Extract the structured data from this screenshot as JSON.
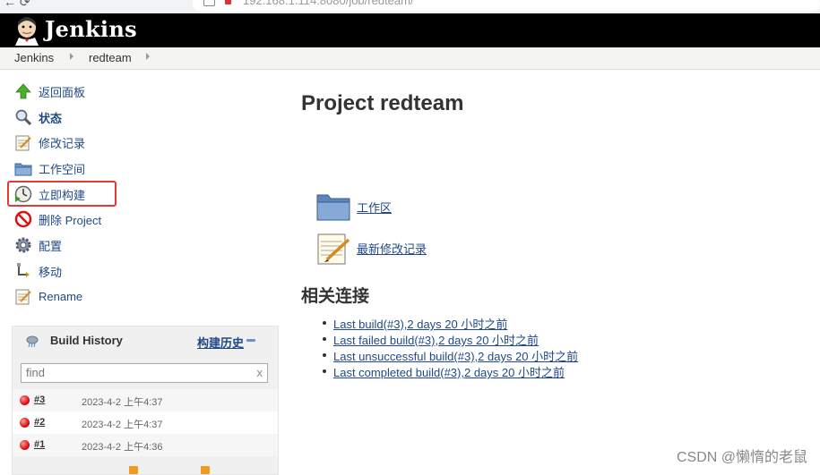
{
  "browser": {
    "nav": "←  ⟳",
    "address": "192.168.1.114:8080/job/redteam/"
  },
  "header": {
    "app_name": "Jenkins"
  },
  "breadcrumb": {
    "items": [
      "Jenkins",
      "redteam"
    ]
  },
  "sidebar": {
    "tasks": [
      {
        "label": "返回面板",
        "icon": "up-arrow-icon"
      },
      {
        "label": "状态",
        "icon": "search-icon"
      },
      {
        "label": "修改记录",
        "icon": "notepad-icon"
      },
      {
        "label": "工作空间",
        "icon": "folder-icon"
      },
      {
        "label": "立即构建",
        "icon": "clock-icon"
      },
      {
        "label": "删除 Project",
        "icon": "no-entry-icon"
      },
      {
        "label": "配置",
        "icon": "gear-icon"
      },
      {
        "label": "移动",
        "icon": "move-icon"
      },
      {
        "label": "Rename",
        "icon": "notepad-icon"
      }
    ]
  },
  "build_history": {
    "title": "Build History",
    "trend_label": "构建历史",
    "search_placeholder": "find",
    "clear": "x",
    "builds": [
      {
        "number": "#3",
        "date": "2023-4-2 上午4:37",
        "status": "failed"
      },
      {
        "number": "#2",
        "date": "2023-4-2 上午4:37",
        "status": "failed"
      },
      {
        "number": "#1",
        "date": "2023-4-2 上午4:36",
        "status": "failed"
      }
    ]
  },
  "main": {
    "title": "Project redteam",
    "links": [
      {
        "label": "工作区",
        "icon": "folder-icon"
      },
      {
        "label": "最新修改记录",
        "icon": "notepad-icon"
      }
    ],
    "related_title": "相关连接",
    "permalinks": [
      "Last build(#3),2 days 20 小时之前",
      "Last failed build(#3),2 days 20 小时之前",
      "Last unsuccessful build(#3),2 days 20 小时之前",
      "Last completed build(#3),2 days 20 小时之前"
    ]
  },
  "watermark": "CSDN @懒惰的老鼠",
  "colors": {
    "link": "#204a87",
    "header": "#000000",
    "highlight": "#e53935"
  }
}
